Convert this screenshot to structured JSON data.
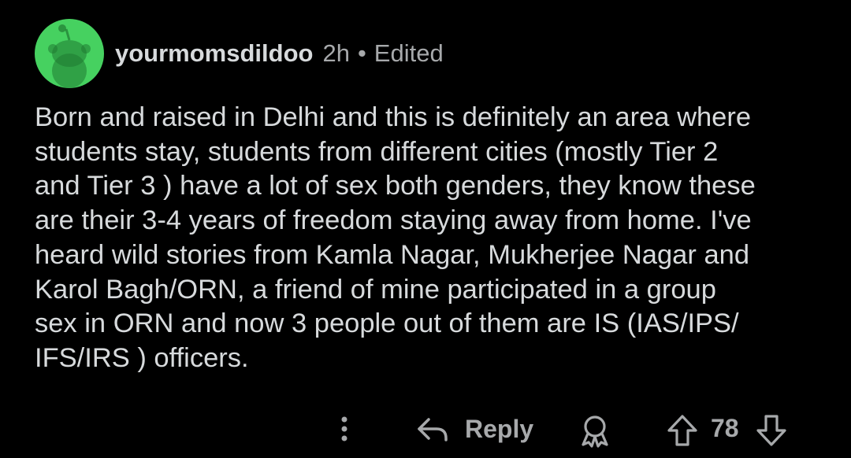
{
  "comment": {
    "username": "yourmomsdildoo",
    "time": "2h",
    "separator": "•",
    "edited": "Edited",
    "body_lines": [
      "Born and raised in Delhi and this is definitely an area where",
      "students stay, students from different cities (mostly Tier 2",
      "and Tier 3 ) have a lot of sex both genders, they know these",
      "are their 3-4 years of freedom staying away from home. I've",
      "heard wild stories from Kamla Nagar, Mukherjee Nagar and",
      "Karol Bagh/ORN, a friend of mine participated in a group",
      "sex in ORN and now 3 people out of them are IS (IAS/IPS/",
      "IFS/IRS ) officers."
    ]
  },
  "actions": {
    "more_icon": "more-vertical-icon",
    "reply_icon": "reply-arrow-icon",
    "reply_label": "Reply",
    "award_icon": "award-icon",
    "upvote_icon": "upvote-arrow-icon",
    "score": "78",
    "downvote_icon": "downvote-arrow-icon"
  },
  "colors": {
    "background": "#000000",
    "text": "#d7dadc",
    "muted": "#a7a9ab",
    "avatar": "#46d160"
  }
}
